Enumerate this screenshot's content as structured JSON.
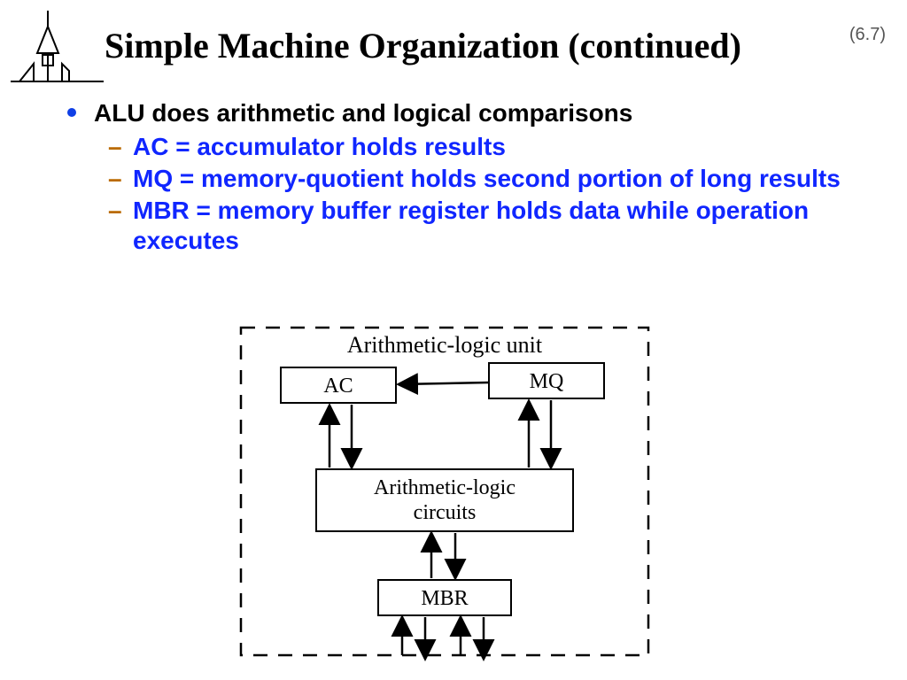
{
  "page_number": "(6.7)",
  "title": "Simple Machine Organization (continued)",
  "bullets": {
    "b1": "ALU does arithmetic and logical comparisons",
    "b2a": "AC = accumulator holds results",
    "b2b": "MQ = memory-quotient holds second portion of long results",
    "b2c": "MBR = memory buffer register holds data while operation executes"
  },
  "diagram": {
    "caption": "Arithmetic-logic unit",
    "boxes": {
      "ac": "AC",
      "mq": "MQ",
      "circuits": "Arithmetic-logic\ncircuits",
      "mbr": "MBR"
    }
  }
}
